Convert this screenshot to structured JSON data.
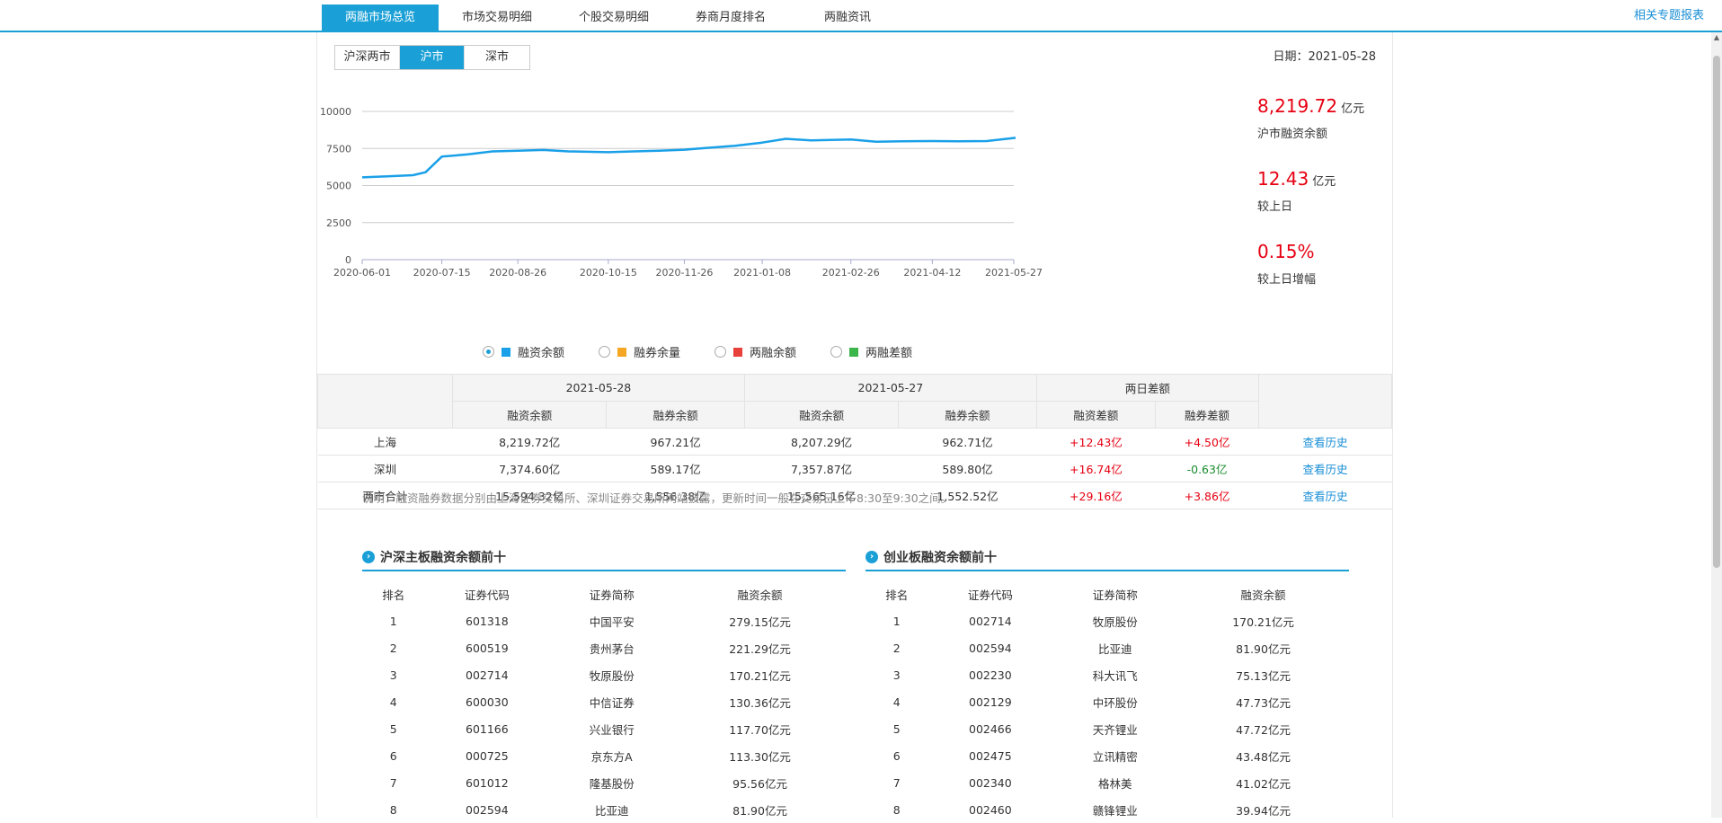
{
  "nav": {
    "tabs": [
      "两融市场总览",
      "市场交易明细",
      "个股交易明细",
      "券商月度排名",
      "两融资讯"
    ],
    "active": 0,
    "special_link": "相关专题报表"
  },
  "market_tabs": {
    "items": [
      "沪深两市",
      "沪市",
      "深市"
    ],
    "active": 1
  },
  "date_text": "日期：2021-05-28",
  "stats": {
    "balance": {
      "value": "8,219.72",
      "unit": "亿元",
      "label": "沪市融资余额"
    },
    "change": {
      "value": "12.43",
      "unit": "亿元",
      "label": "较上日"
    },
    "pct": {
      "value": "0.15%",
      "label": "较上日增幅"
    }
  },
  "legend": [
    {
      "label": "融资余额",
      "color": "#1aa0e8",
      "selected": true
    },
    {
      "label": "融券余量",
      "color": "#f5a623",
      "selected": false
    },
    {
      "label": "两融余额",
      "color": "#e8403a",
      "selected": false
    },
    {
      "label": "两融差额",
      "color": "#3cb54a",
      "selected": false
    }
  ],
  "chart_data": {
    "type": "line",
    "x": [
      "2020-06-01",
      "2020-06-15",
      "2020-06-29",
      "2020-07-06",
      "2020-07-15",
      "2020-07-29",
      "2020-08-12",
      "2020-08-26",
      "2020-09-09",
      "2020-09-23",
      "2020-10-15",
      "2020-10-29",
      "2020-11-12",
      "2020-11-26",
      "2020-12-10",
      "2020-12-24",
      "2021-01-08",
      "2021-01-21",
      "2021-02-04",
      "2021-02-26",
      "2021-03-12",
      "2021-03-26",
      "2021-04-12",
      "2021-04-26",
      "2021-05-12",
      "2021-05-28"
    ],
    "series": [
      {
        "name": "融资余额",
        "values": [
          5550,
          5620,
          5700,
          5900,
          6950,
          7100,
          7300,
          7350,
          7400,
          7300,
          7250,
          7300,
          7350,
          7420,
          7550,
          7680,
          7900,
          8150,
          8050,
          8100,
          7950,
          7980,
          8000,
          7990,
          8000,
          8219.72
        ]
      }
    ],
    "xticks": [
      "2020-06-01",
      "2020-07-15",
      "2020-08-26",
      "2020-10-15",
      "2020-11-26",
      "2021-01-08",
      "2021-02-26",
      "2021-04-12",
      "2021-05-27"
    ],
    "yticks": [
      0,
      2500,
      5000,
      7500,
      10000
    ],
    "ylim": [
      0,
      10000
    ]
  },
  "compare": {
    "groups": [
      "2021-05-28",
      "2021-05-27",
      "两日差额"
    ],
    "subheads": [
      "融资余额",
      "融券余额",
      "融资余额",
      "融券余额",
      "融资差额",
      "融券差额"
    ],
    "rows": [
      {
        "name": "上海",
        "cells": [
          "8,219.72亿",
          "967.21亿",
          "8,207.29亿",
          "962.71亿",
          "+12.43亿",
          "+4.50亿"
        ],
        "link": "查看历史"
      },
      {
        "name": "深圳",
        "cells": [
          "7,374.60亿",
          "589.17亿",
          "7,357.87亿",
          "589.80亿",
          "+16.74亿",
          "-0.63亿"
        ],
        "link": "查看历史"
      },
      {
        "name": "两市合计",
        "cells": [
          "15,594.32亿",
          "1,556.38亿",
          "15,565.16亿",
          "1,552.52亿",
          "+29.16亿",
          "+3.86亿"
        ],
        "link": "查看历史"
      }
    ]
  },
  "note": "说明：融资融券数据分别由上海证券交易所、深圳证券交易所网站披露，更新时间一般在交易日上午8:30至9:30之间。",
  "top_main": {
    "title": "沪深主板融资余额前十",
    "headers": [
      "排名",
      "证券代码",
      "证券简称",
      "融资余额"
    ],
    "rows": [
      [
        "1",
        "601318",
        "中国平安",
        "279.15亿元"
      ],
      [
        "2",
        "600519",
        "贵州茅台",
        "221.29亿元"
      ],
      [
        "3",
        "002714",
        "牧原股份",
        "170.21亿元"
      ],
      [
        "4",
        "600030",
        "中信证券",
        "130.36亿元"
      ],
      [
        "5",
        "601166",
        "兴业银行",
        "117.70亿元"
      ],
      [
        "6",
        "000725",
        "京东方A",
        "113.30亿元"
      ],
      [
        "7",
        "601012",
        "隆基股份",
        "95.56亿元"
      ],
      [
        "8",
        "002594",
        "比亚迪",
        "81.90亿元"
      ]
    ]
  },
  "top_gem": {
    "title": "创业板融资余额前十",
    "headers": [
      "排名",
      "证券代码",
      "证券简称",
      "融资余额"
    ],
    "rows": [
      [
        "1",
        "002714",
        "牧原股份",
        "170.21亿元"
      ],
      [
        "2",
        "002594",
        "比亚迪",
        "81.90亿元"
      ],
      [
        "3",
        "002230",
        "科大讯飞",
        "75.13亿元"
      ],
      [
        "4",
        "002129",
        "中环股份",
        "47.73亿元"
      ],
      [
        "5",
        "002466",
        "天齐锂业",
        "47.72亿元"
      ],
      [
        "6",
        "002475",
        "立讯精密",
        "43.48亿元"
      ],
      [
        "7",
        "002340",
        "格林美",
        "41.02亿元"
      ],
      [
        "8",
        "002460",
        "赣锋锂业",
        "39.94亿元"
      ]
    ]
  }
}
